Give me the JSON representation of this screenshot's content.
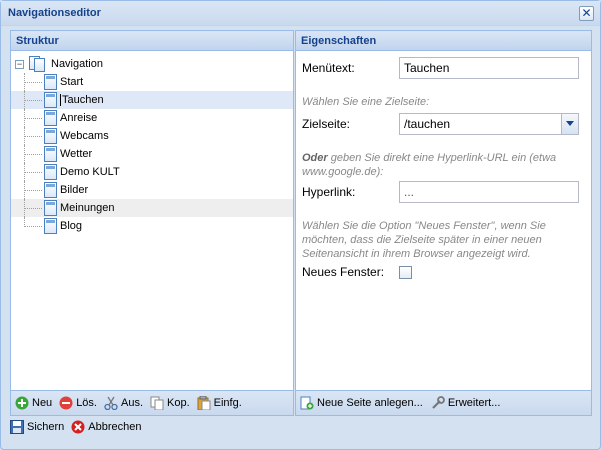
{
  "window": {
    "title": "Navigationseditor",
    "close_glyph": "✕"
  },
  "structure": {
    "header": "Struktur",
    "root_label": "Navigation",
    "expander_glyph": "−",
    "items": [
      {
        "label": "Start"
      },
      {
        "label": "Tauchen"
      },
      {
        "label": "Anreise"
      },
      {
        "label": "Webcams"
      },
      {
        "label": "Wetter"
      },
      {
        "label": "Demo KULT"
      },
      {
        "label": "Bilder"
      },
      {
        "label": "Meinungen"
      },
      {
        "label": "Blog"
      }
    ],
    "selected_index": 1,
    "hover_index": 7,
    "toolbar": {
      "new": "Neu",
      "delete": "Lös.",
      "cut": "Aus.",
      "copy": "Kop.",
      "paste": "Einfg."
    }
  },
  "properties": {
    "header": "Eigenschaften",
    "menutext_label": "Menütext:",
    "menutext_value": "Tauchen",
    "target_hint": "Wählen Sie eine Zielseite:",
    "target_label": "Zielseite:",
    "target_value": "/tauchen",
    "url_hint_bold": "Oder",
    "url_hint_rest": " geben Sie direkt eine Hyperlink-URL ein (etwa www.google.de):",
    "hyperlink_label": "Hyperlink:",
    "hyperlink_value": "...",
    "newwindow_hint": "Wählen Sie die Option \"Neues Fenster\", wenn Sie möchten, dass die Zielseite später in einer neuen Seitenansicht in ihrem Browser angezeigt wird.",
    "newwindow_label": "Neues Fenster:",
    "newwindow_checked": false,
    "toolbar": {
      "new_page": "Neue Seite anlegen...",
      "advanced": "Erweitert..."
    }
  },
  "footer": {
    "save": "Sichern",
    "cancel": "Abbrechen"
  },
  "colors": {
    "header_text": "#15428b",
    "selected_row": "#dfe8f6",
    "hover_row": "#eeeeee",
    "add_icon": "#3aa63a",
    "delete_icon": "#e0403a",
    "cancel_icon": "#d32020"
  }
}
